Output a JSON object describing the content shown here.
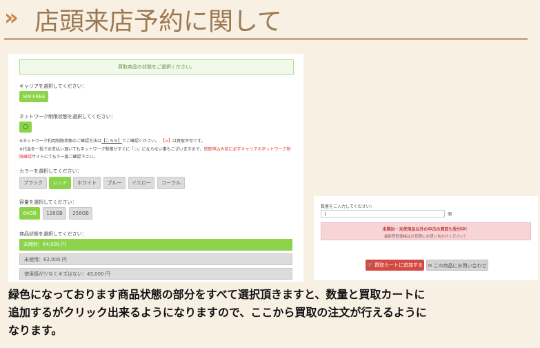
{
  "header": {
    "chevron": "»",
    "title": "店頭来店予約に関して"
  },
  "form": {
    "banner": "買取商品の状態をご選択ください。",
    "carrier_label": "キャリアを選択してください：",
    "carrier_option": "SIM FREE",
    "network_label": "ネットワーク制限状態を選択してください：",
    "network_option": "○",
    "note1_a": "※ネットワーク利用制限状態のご確認方法は",
    "note1_link": "【こちら】",
    "note1_b": "でご確認ください。",
    "note1_mark": "【×】",
    "note1_c": "は買取不可です。",
    "note2_a": "※代金を一括でお支払い頂いてもネットワーク制限がすぐに「○」にならない事もございますので、",
    "note2_red": "買取申込み前に必ずキャリアのネットワーク制",
    "note3_red": "限確認",
    "note3_b": "サイトにてもう一度ご確認下さい。",
    "color_label": "カラーを選択してください：",
    "colors": [
      "ブラック",
      "レッド",
      "ホワイト",
      "ブルー",
      "イエロー",
      "コーラル"
    ],
    "selected_color": "レッド",
    "capacity_label": "容量を選択してください：",
    "capacities": [
      "64GB",
      "128GB",
      "256GB"
    ],
    "selected_capacity": "64GB",
    "condition_label": "商品状態を選択してください：",
    "conditions": [
      "未開封：64,000 円",
      "未使用：62,000 円",
      "使用感が少なくキズはない：43,000 円"
    ],
    "selected_condition": "未開封：64,000 円"
  },
  "purchase": {
    "qty_label": "数量をご入力してください：",
    "qty_value": "1",
    "qty_unit": "個",
    "alert_title": "未開封・未使用品以外の中古の買取も受付中！",
    "alert_body": "最新買取価格はお気軽にお問い合わせください！",
    "cart_button": "買取カートに追加する",
    "contact_button": "この商品にお問い合わせ"
  },
  "caption": {
    "line1": "緑色になっております商品状態の部分をすべて選択頂きますと、数量と買取カートに",
    "line2": "追加するがクリック出来るようになりますので、ここから買取の注文が行えるように",
    "line3": "なります。"
  },
  "colors": {
    "accent_green": "#8bd44a",
    "cart_red": "#d44a43",
    "title_brown": "#9d7850"
  }
}
